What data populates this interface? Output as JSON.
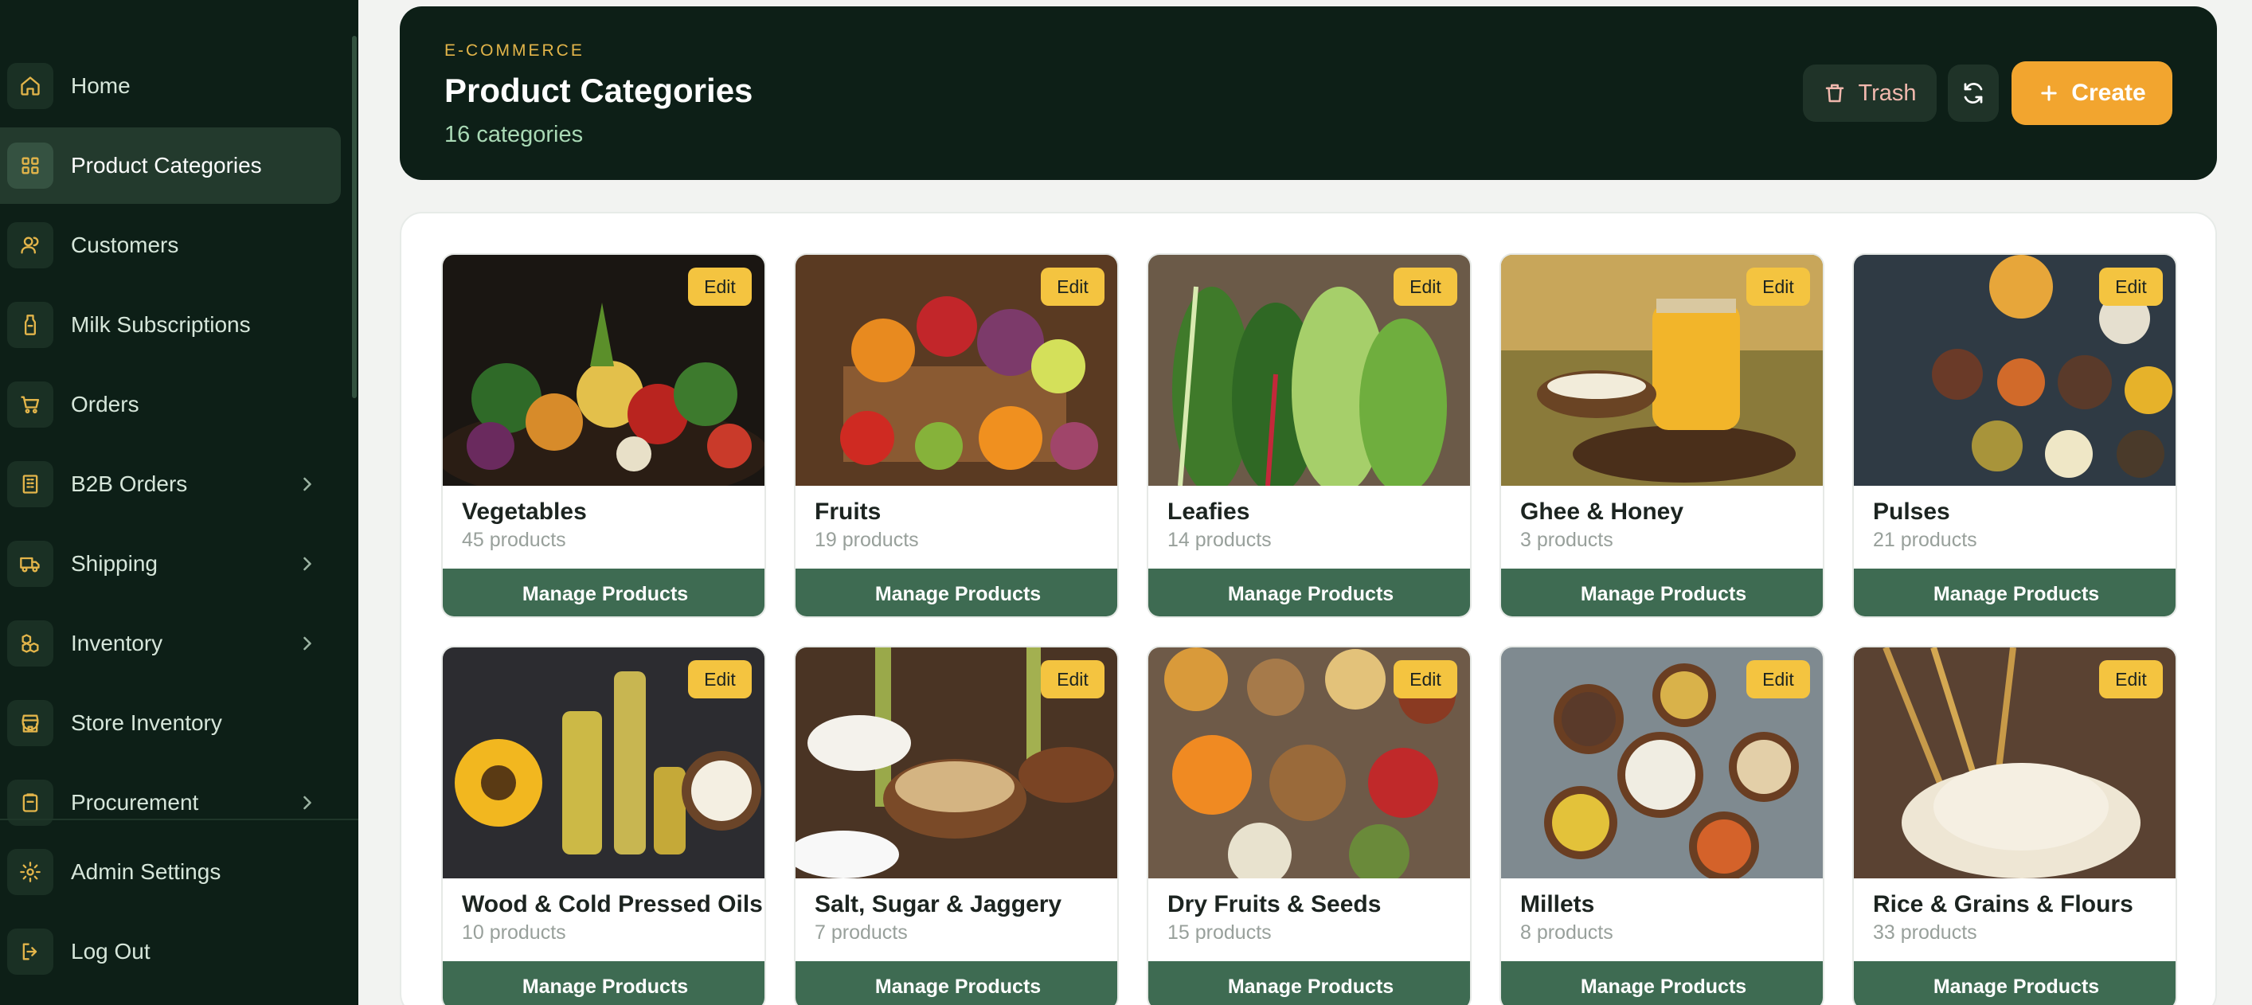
{
  "sidebar": {
    "items": [
      {
        "label": "Home",
        "icon": "home-icon",
        "active": false,
        "chevron": false
      },
      {
        "label": "Product Categories",
        "icon": "grid-icon",
        "active": true,
        "chevron": false
      },
      {
        "label": "Customers",
        "icon": "users-icon",
        "active": false,
        "chevron": false
      },
      {
        "label": "Milk Subscriptions",
        "icon": "milk-bottle-icon",
        "active": false,
        "chevron": false
      },
      {
        "label": "Orders",
        "icon": "cart-icon",
        "active": false,
        "chevron": false
      },
      {
        "label": "B2B Orders",
        "icon": "building-icon",
        "active": false,
        "chevron": true
      },
      {
        "label": "Shipping",
        "icon": "truck-icon",
        "active": false,
        "chevron": true
      },
      {
        "label": "Inventory",
        "icon": "boxes-icon",
        "active": false,
        "chevron": true
      },
      {
        "label": "Store Inventory",
        "icon": "store-icon",
        "active": false,
        "chevron": false
      },
      {
        "label": "Procurement",
        "icon": "clipboard-icon",
        "active": false,
        "chevron": true
      }
    ],
    "footer": [
      {
        "label": "Admin Settings",
        "icon": "gear-icon"
      },
      {
        "label": "Log Out",
        "icon": "logout-icon"
      }
    ]
  },
  "header": {
    "eyebrow": "E-COMMERCE",
    "title": "Product Categories",
    "subtitle": "16 categories",
    "trash_label": "Trash",
    "create_label": "Create"
  },
  "colors": {
    "sidebar_bg": "#0d1f17",
    "accent": "#f2a52f",
    "edit_badge": "#f4c440",
    "manage_button": "#3e6b52"
  },
  "categories": [
    {
      "name": "Vegetables",
      "count": "45 products",
      "edit": "Edit",
      "manage": "Manage Products"
    },
    {
      "name": "Fruits",
      "count": "19 products",
      "edit": "Edit",
      "manage": "Manage Products"
    },
    {
      "name": "Leafies",
      "count": "14 products",
      "edit": "Edit",
      "manage": "Manage Products"
    },
    {
      "name": "Ghee & Honey",
      "count": "3 products",
      "edit": "Edit",
      "manage": "Manage Products"
    },
    {
      "name": "Pulses",
      "count": "21 products",
      "edit": "Edit",
      "manage": "Manage Products"
    },
    {
      "name": "Wood & Cold Pressed Oils",
      "count": "10 products",
      "edit": "Edit",
      "manage": "Manage Products"
    },
    {
      "name": "Salt, Sugar & Jaggery",
      "count": "7 products",
      "edit": "Edit",
      "manage": "Manage Products"
    },
    {
      "name": "Dry Fruits & Seeds",
      "count": "15 products",
      "edit": "Edit",
      "manage": "Manage Products"
    },
    {
      "name": "Millets",
      "count": "8 products",
      "edit": "Edit",
      "manage": "Manage Products"
    },
    {
      "name": "Rice & Grains & Flours",
      "count": "33 products",
      "edit": "Edit",
      "manage": "Manage Products"
    }
  ]
}
